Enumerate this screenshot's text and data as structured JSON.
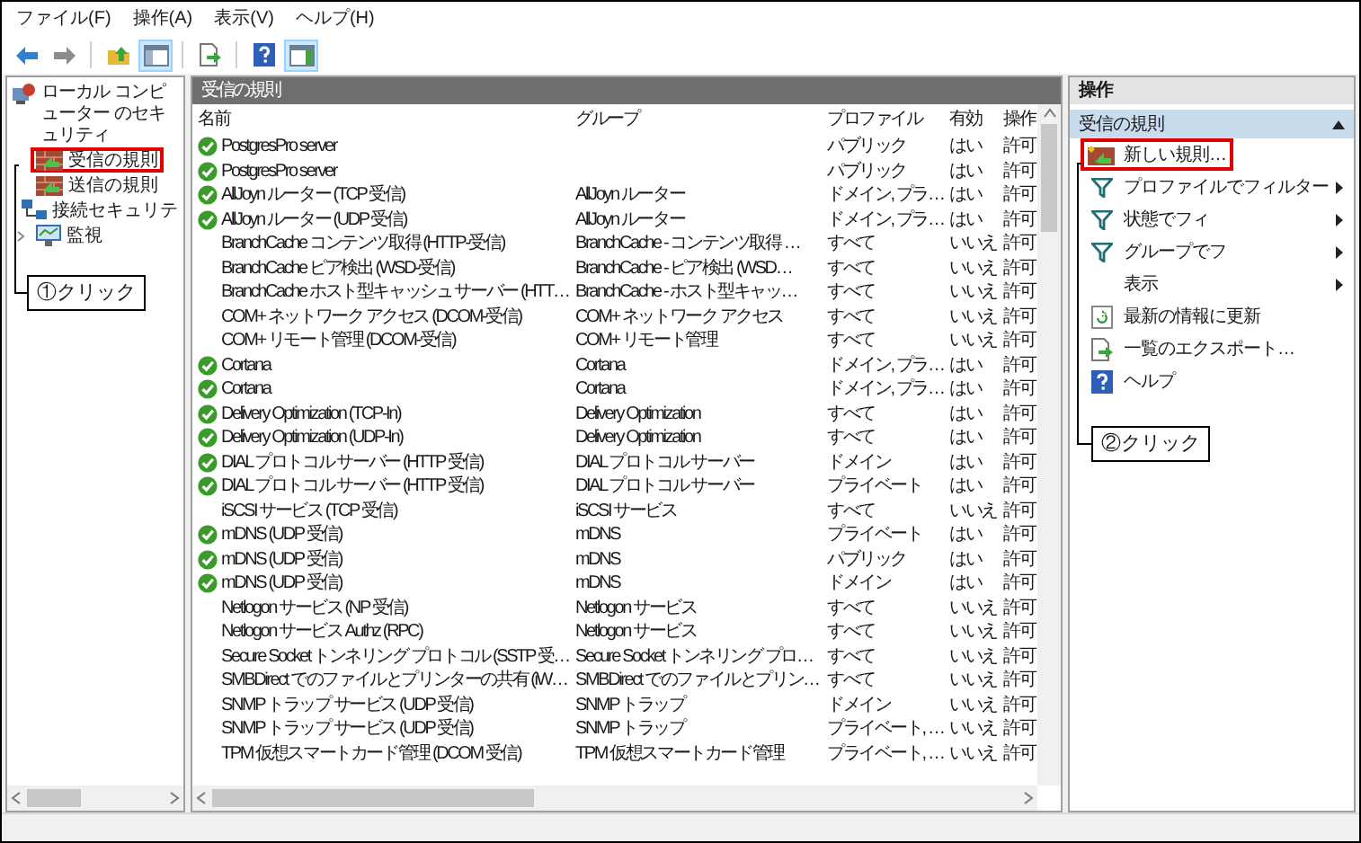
{
  "menu": [
    {
      "label": "ファイル(F)"
    },
    {
      "label": "操作(A)"
    },
    {
      "label": "表示(V)"
    },
    {
      "label": "ヘルプ(H)"
    }
  ],
  "toolbar": [
    {
      "kind": "back",
      "disabled": false
    },
    {
      "kind": "forward",
      "disabled": true
    },
    {
      "kind": "up",
      "pressed": false
    },
    {
      "kind": "tree",
      "pressed": true
    },
    {
      "kind": "export",
      "pressed": false
    },
    {
      "kind": "help",
      "pressed": false
    },
    {
      "kind": "pane",
      "pressed": true
    }
  ],
  "tree": {
    "items": [
      {
        "label": "ローカル コンピューター のセキュリティ",
        "kind": "computer",
        "children": [
          {
            "label": "受信の規則",
            "kind": "firewall",
            "highlighted": true
          },
          {
            "label": "送信の規則",
            "kind": "firewall",
            "highlighted": false
          },
          {
            "label": "接続セキュリテ",
            "kind": "network",
            "highlighted": false
          },
          {
            "label": "監視",
            "kind": "monitor",
            "highlighted": false,
            "expanded": false
          }
        ]
      }
    ]
  },
  "rules": {
    "title": "受信の規則",
    "columns": [
      "名前",
      "グループ",
      "プロファイル",
      "有効",
      "操作"
    ],
    "rows": [
      {
        "enabled": true,
        "name": "PostgresPro server",
        "profile": "パブリック",
        "active": "はい",
        "action": "許可"
      },
      {
        "enabled": true,
        "name": "PostgresPro server",
        "profile": "パブリック",
        "active": "はい",
        "action": "許可"
      },
      {
        "enabled": true,
        "name": "AllJoyn ルーター (TCP 受信)",
        "group": "AllJoyn ルーター",
        "profile": "ドメイン, プラ…",
        "active": "はい",
        "action": "許可"
      },
      {
        "enabled": true,
        "name": "AllJoyn ルーター (UDP 受信)",
        "group": "AllJoyn ルーター",
        "profile": "ドメイン, プラ…",
        "active": "はい",
        "action": "許可"
      },
      {
        "enabled": false,
        "name": "BranchCache コンテンツ取得 (HTTP-受信)",
        "group": "BranchCache - コンテンツ取得 …",
        "profile": "すべて",
        "active": "いいえ",
        "action": "許可"
      },
      {
        "enabled": false,
        "name": "BranchCache ピア検出 (WSD-受信)",
        "group": "BranchCache - ピア検出 (WSD…",
        "profile": "すべて",
        "active": "いいえ",
        "action": "許可"
      },
      {
        "enabled": false,
        "name": "BranchCache ホスト型キャッシュ サーバー (HTT…",
        "group": "BranchCache - ホスト型キャッ…",
        "profile": "すべて",
        "active": "いいえ",
        "action": "許可"
      },
      {
        "enabled": false,
        "name": "COM+ ネットワーク アクセス (DCOM-受信)",
        "group": "COM+ ネットワーク アクセス",
        "profile": "すべて",
        "active": "いいえ",
        "action": "許可"
      },
      {
        "enabled": false,
        "name": "COM+ リモート管理 (DCOM-受信)",
        "group": "COM+ リモート管理",
        "profile": "すべて",
        "active": "いいえ",
        "action": "許可"
      },
      {
        "enabled": true,
        "name": "Cortana",
        "group": "Cortana",
        "profile": "ドメイン, プラ…",
        "active": "はい",
        "action": "許可"
      },
      {
        "enabled": true,
        "name": "Cortana",
        "group": "Cortana",
        "profile": "ドメイン, プラ…",
        "active": "はい",
        "action": "許可"
      },
      {
        "enabled": true,
        "name": "Delivery Optimization (TCP-In)",
        "group": "Delivery Optimization",
        "profile": "すべて",
        "active": "はい",
        "action": "許可"
      },
      {
        "enabled": true,
        "name": "Delivery Optimization (UDP-In)",
        "group": "Delivery Optimization",
        "profile": "すべて",
        "active": "はい",
        "action": "許可"
      },
      {
        "enabled": true,
        "name": "DIAL プロトコル サーバー (HTTP 受信)",
        "group": "DIAL プロトコル サーバー",
        "profile": "ドメイン",
        "active": "はい",
        "action": "許可"
      },
      {
        "enabled": true,
        "name": "DIAL プロトコル サーバー (HTTP 受信)",
        "group": "DIAL プロトコル サーバー",
        "profile": "プライベート",
        "active": "はい",
        "action": "許可"
      },
      {
        "enabled": false,
        "name": "iSCSI サービス (TCP 受信)",
        "group": "iSCSI サービス",
        "profile": "すべて",
        "active": "いいえ",
        "action": "許可"
      },
      {
        "enabled": true,
        "name": "mDNS (UDP 受信)",
        "group": "mDNS",
        "profile": "プライベート",
        "active": "はい",
        "action": "許可"
      },
      {
        "enabled": true,
        "name": "mDNS (UDP 受信)",
        "group": "mDNS",
        "profile": "パブリック",
        "active": "はい",
        "action": "許可"
      },
      {
        "enabled": true,
        "name": "mDNS (UDP 受信)",
        "group": "mDNS",
        "profile": "ドメイン",
        "active": "はい",
        "action": "許可"
      },
      {
        "enabled": false,
        "name": "Netlogon サービス (NP 受信)",
        "group": "Netlogon サービス",
        "profile": "すべて",
        "active": "いいえ",
        "action": "許可"
      },
      {
        "enabled": false,
        "name": "Netlogon サービス Authz (RPC)",
        "group": "Netlogon サービス",
        "profile": "すべて",
        "active": "いいえ",
        "action": "許可"
      },
      {
        "enabled": false,
        "name": "Secure Socket トンネリング プロトコル (SSTP 受…",
        "group": "Secure Socket トンネリング プロ…",
        "profile": "すべて",
        "active": "いいえ",
        "action": "許可"
      },
      {
        "enabled": false,
        "name": "SMBDirect でのファイルとプリンターの共有 (iW…",
        "group": "SMBDirect でのファイルとプリン…",
        "profile": "すべて",
        "active": "いいえ",
        "action": "許可"
      },
      {
        "enabled": false,
        "name": "SNMP トラップ サービス (UDP 受信)",
        "group": "SNMP トラップ",
        "profile": "ドメイン",
        "active": "いいえ",
        "action": "許可"
      },
      {
        "enabled": false,
        "name": "SNMP トラップ サービス (UDP 受信)",
        "group": "SNMP トラップ",
        "profile": "プライベート, …",
        "active": "いいえ",
        "action": "許可"
      },
      {
        "enabled": false,
        "name": "TPM 仮想スマートカード管理 (DCOM 受信)",
        "group": "TPM 仮想スマートカード管理",
        "profile": "プライベート, …",
        "active": "いいえ",
        "action": "許可"
      }
    ]
  },
  "actions": {
    "title": "操作",
    "section": {
      "label": "受信の規則",
      "expanded": true
    },
    "items": [
      {
        "label": "新しい規則…",
        "kind": "new-rule",
        "highlighted": true
      },
      {
        "label": "プロファイルでフィルター",
        "kind": "filter",
        "submenu": true
      },
      {
        "label": "状態でフィ",
        "kind": "filter",
        "submenu": true
      },
      {
        "label": "グループでフ",
        "kind": "filter",
        "submenu": true
      },
      {
        "label": "表示",
        "kind": "none",
        "submenu": true
      },
      {
        "label": "最新の情報に更新",
        "kind": "refresh"
      },
      {
        "label": "一覧のエクスポート…",
        "kind": "export"
      },
      {
        "label": "ヘルプ",
        "kind": "help"
      }
    ]
  },
  "annotations": [
    {
      "label": "①クリック"
    },
    {
      "label": "②クリック"
    }
  ]
}
